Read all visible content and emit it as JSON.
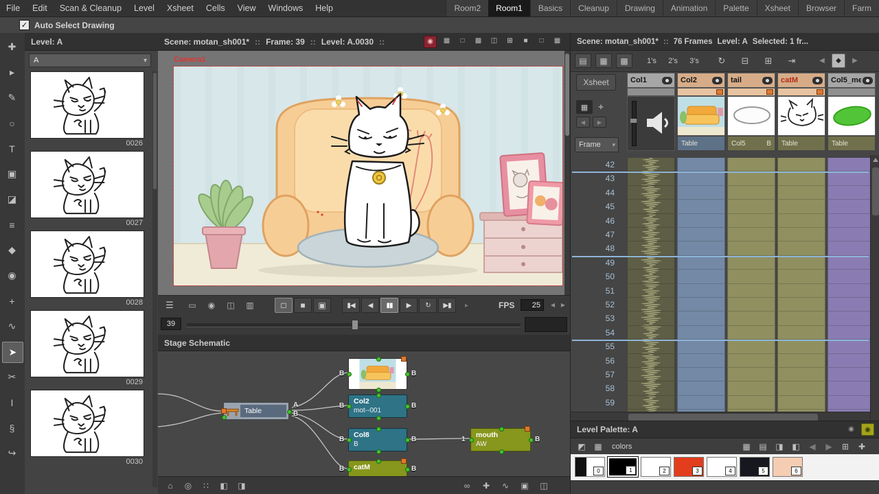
{
  "menu_bar": {
    "items": [
      "File",
      "Edit",
      "Scan & Cleanup",
      "Level",
      "Xsheet",
      "Cells",
      "View",
      "Windows",
      "Help"
    ]
  },
  "room_tabs": [
    {
      "label": "Room2",
      "active": false
    },
    {
      "label": "Room1",
      "active": true
    },
    {
      "label": "Basics",
      "active": false
    },
    {
      "label": "Cleanup",
      "active": false
    },
    {
      "label": "Drawing",
      "active": false
    },
    {
      "label": "Animation",
      "active": false
    },
    {
      "label": "Palette",
      "active": false
    },
    {
      "label": "Xsheet",
      "active": false
    },
    {
      "label": "Browser",
      "active": false
    },
    {
      "label": "Farm",
      "active": false
    }
  ],
  "options_bar": {
    "auto_select_label": "Auto Select Drawing",
    "checkmark": "✓"
  },
  "tools": [
    {
      "name": "animate-tool",
      "glyph": "✚"
    },
    {
      "name": "selection-tool",
      "glyph": "▸"
    },
    {
      "name": "brush-tool",
      "glyph": "✎"
    },
    {
      "name": "geometric-tool",
      "glyph": "○"
    },
    {
      "name": "type-tool",
      "glyph": "T"
    },
    {
      "name": "fill-tool",
      "glyph": "▣"
    },
    {
      "name": "eraser-tool",
      "glyph": "◪"
    },
    {
      "name": "tape-tool",
      "glyph": "≡"
    },
    {
      "name": "style-picker-tool",
      "glyph": "◆"
    },
    {
      "name": "rgb-picker-tool",
      "glyph": "◉"
    },
    {
      "name": "control-point-tool",
      "glyph": "+"
    },
    {
      "name": "pinch-tool",
      "glyph": "∿"
    },
    {
      "name": "selection-tool-active",
      "glyph": "➤",
      "active": true
    },
    {
      "name": "cutter-tool",
      "glyph": "✂"
    },
    {
      "name": "iron-tool",
      "glyph": "I"
    },
    {
      "name": "skeleton-tool",
      "glyph": "§"
    },
    {
      "name": "hook-tool",
      "glyph": "↪"
    }
  ],
  "level_strip": {
    "header": "Level:  A",
    "combo_value": "A",
    "combo_arrow": "▾",
    "frames": [
      "0026",
      "0027",
      "0028",
      "0029",
      "0030"
    ]
  },
  "viewer": {
    "scene": "Scene: motan_sh001*",
    "sep": "::",
    "frame": "Frame: 39",
    "level": "Level: A.0030",
    "camera": "Camera1",
    "title_icons": [
      {
        "name": "preview-toggle-icon",
        "glyph": "◉",
        "accent": "red"
      },
      {
        "name": "sub-camera-icon",
        "glyph": "▦"
      },
      {
        "name": "camera-stand-view-icon",
        "glyph": "□"
      },
      {
        "name": "3d-view-icon",
        "glyph": "▩"
      },
      {
        "name": "camera-view-icon",
        "glyph": "◫"
      },
      {
        "name": "freeze-icon",
        "glyph": "⊞"
      },
      {
        "name": "black-bg-icon",
        "glyph": "■"
      },
      {
        "name": "white-bg-icon",
        "glyph": "□"
      },
      {
        "name": "checkered-bg-icon",
        "glyph": "▦"
      }
    ]
  },
  "playback": {
    "icons": [
      {
        "name": "playbar-menu-icon",
        "glyph": "☰"
      },
      {
        "name": "clapper-icon",
        "glyph": "▭"
      },
      {
        "name": "snapshot-icon",
        "glyph": "◉"
      },
      {
        "name": "compare-icon",
        "glyph": "◫"
      },
      {
        "name": "histogram-icon",
        "glyph": "▥"
      }
    ],
    "view_toggles": [
      {
        "name": "standard-view-toggle",
        "glyph": "□",
        "active": true
      },
      {
        "name": "3d-view-toggle",
        "glyph": "■"
      },
      {
        "name": "camera-view-toggle",
        "glyph": "▣"
      }
    ],
    "transport": [
      {
        "name": "first-frame-button",
        "glyph": "▮◀"
      },
      {
        "name": "prev-frame-button",
        "glyph": "◀"
      },
      {
        "name": "pause-button",
        "glyph": "▮▮",
        "active": true
      },
      {
        "name": "play-button",
        "glyph": "▶"
      },
      {
        "name": "loop-button",
        "glyph": "↻"
      },
      {
        "name": "last-frame-button",
        "glyph": "▶▮"
      },
      {
        "name": "playback-options-icon",
        "glyph": "▸",
        "dim": true
      }
    ],
    "fps_label": "FPS",
    "fps_value": "25",
    "spin_left": "◀",
    "spin_right": "▶"
  },
  "frame_slider": {
    "value": "39"
  },
  "schematic": {
    "title": "Stage Schematic",
    "nodes": [
      {
        "label": "Table",
        "kind": "table",
        "out_ports": [
          "A",
          "B"
        ]
      },
      {
        "label": "",
        "kind": "thumb",
        "in_port": "B",
        "out_port": "B"
      },
      {
        "label": "Col2",
        "sublabel": "mot--001",
        "kind": "level",
        "in_port": "B",
        "out_port": "B"
      },
      {
        "label": "Col8",
        "sublabel": "B",
        "kind": "level",
        "in_port": "B",
        "out_port": "B"
      },
      {
        "label": "catM",
        "sublabel": "",
        "kind": "mesh",
        "in_port": "B",
        "out_port": "B"
      },
      {
        "label": "mouth",
        "sublabel": "AW",
        "kind": "mesh",
        "in_port": "1",
        "out_port": "B"
      }
    ],
    "toolbar_left": [
      {
        "name": "fit-schematic-icon",
        "glyph": "⌂"
      },
      {
        "name": "focus-node-icon",
        "glyph": "◎"
      },
      {
        "name": "reorder-nodes-icon",
        "glyph": "∷"
      },
      {
        "name": "minimize-nodes-icon",
        "glyph": "◧"
      },
      {
        "name": "maximize-nodes-icon",
        "glyph": "◨"
      }
    ],
    "toolbar_right": [
      {
        "name": "link-nodes-icon",
        "glyph": "∞"
      },
      {
        "name": "new-node-icon",
        "glyph": "✚"
      },
      {
        "name": "spline-icon",
        "glyph": "∿"
      },
      {
        "name": "stage-toggle-icon",
        "glyph": "▣"
      },
      {
        "name": "switch-schematic-icon",
        "glyph": "◫"
      }
    ]
  },
  "xsheet": {
    "scene": "Scene: motan_sh001*",
    "sep": "::",
    "frames": "76 Frames",
    "level": "Level: A",
    "selected": "Selected: 1 fr...",
    "toolbar_icons": [
      {
        "name": "new-vector-level-icon",
        "glyph": "▤"
      },
      {
        "name": "new-toonz-level-icon",
        "glyph": "▦"
      },
      {
        "name": "new-raster-level-icon",
        "glyph": "▩"
      }
    ],
    "steps": [
      "1's",
      "2's",
      "3's"
    ],
    "mid_icons": [
      {
        "name": "reframe-icon",
        "glyph": "↻"
      },
      {
        "name": "repeat-icon",
        "glyph": "⊟"
      },
      {
        "name": "paste-icon",
        "glyph": "⊞"
      },
      {
        "name": "nav-arrow-icon",
        "glyph": "⇥"
      }
    ],
    "nav_icons": [
      {
        "name": "prev-key-icon",
        "glyph": "◀",
        "dim": true
      },
      {
        "name": "key-icon",
        "glyph": "◆",
        "light": true
      },
      {
        "name": "next-key-icon",
        "glyph": "▶",
        "dim": true
      }
    ],
    "xsheet_button": "Xsheet",
    "frame_combo": "Frame",
    "combo_arrow": "▾",
    "camera_widget": {
      "icon_glyph": "▦",
      "plus_glyph": "✚",
      "left_glyph": "◀",
      "right_glyph": "▶"
    },
    "columns": [
      {
        "name": "Col1",
        "kind": "sound",
        "header": "gray",
        "bottom": "",
        "cell": "#5e5e46"
      },
      {
        "name": "Col2",
        "kind": "level",
        "header": "tan",
        "bottom": "Table",
        "cell": "#7389a5",
        "thumb": "scene"
      },
      {
        "name": "tail",
        "kind": "level",
        "header": "tan",
        "bottom": "Col5",
        "bottom2": "B",
        "cell": "#8f8f60",
        "thumb": "ellipse"
      },
      {
        "name": "catM",
        "kind": "level",
        "header": "tan",
        "name_color": "#b52c16",
        "bottom": "Table",
        "cell": "#8f8f60",
        "thumb": "cat"
      },
      {
        "name": "Col5_me",
        "kind": "level",
        "header": "gray",
        "bottom": "Table",
        "cell": "#8a7cb2",
        "thumb": "green"
      }
    ],
    "row_start": 42,
    "row_end": 60
  },
  "palette": {
    "title": "Level Palette: A",
    "page_label": "colors",
    "title_icons": [
      {
        "name": "palette-freeze-icon",
        "glyph": "◉"
      },
      {
        "name": "palette-lock-icon",
        "glyph": "◉",
        "accent": "yellow"
      }
    ],
    "toolbar_left": [
      {
        "name": "style-editor-icon",
        "glyph": "◩"
      },
      {
        "name": "palette-gizmo-icon",
        "glyph": "▦"
      }
    ],
    "toolbar_right": [
      {
        "name": "grid-view-icon",
        "glyph": "▦"
      },
      {
        "name": "list-view-icon",
        "glyph": "▤"
      },
      {
        "name": "save-palette-icon",
        "glyph": "◨"
      },
      {
        "name": "save-palette-as-icon",
        "glyph": "◧"
      },
      {
        "name": "prev-page-icon",
        "glyph": "◀"
      },
      {
        "name": "next-page-icon",
        "glyph": "▶"
      },
      {
        "name": "new-page-icon",
        "glyph": "⊞"
      },
      {
        "name": "new-style-icon",
        "glyph": "✚"
      }
    ],
    "swatches": [
      {
        "index": "0",
        "color": "#ffffff",
        "split": true
      },
      {
        "index": "1",
        "color": "#000000",
        "selected": true
      },
      {
        "index": "2",
        "color": "#ffffff"
      },
      {
        "index": "3",
        "color": "#e23d1d"
      },
      {
        "index": "4",
        "color": "#ffffff"
      },
      {
        "index": "5",
        "color": "#17171f"
      },
      {
        "index": "6",
        "color": "#f5cdb3"
      }
    ]
  },
  "colors": {
    "camera_red": "#e23535",
    "marker_blue": "#8fb5d8",
    "port_green": "#46c32e"
  }
}
